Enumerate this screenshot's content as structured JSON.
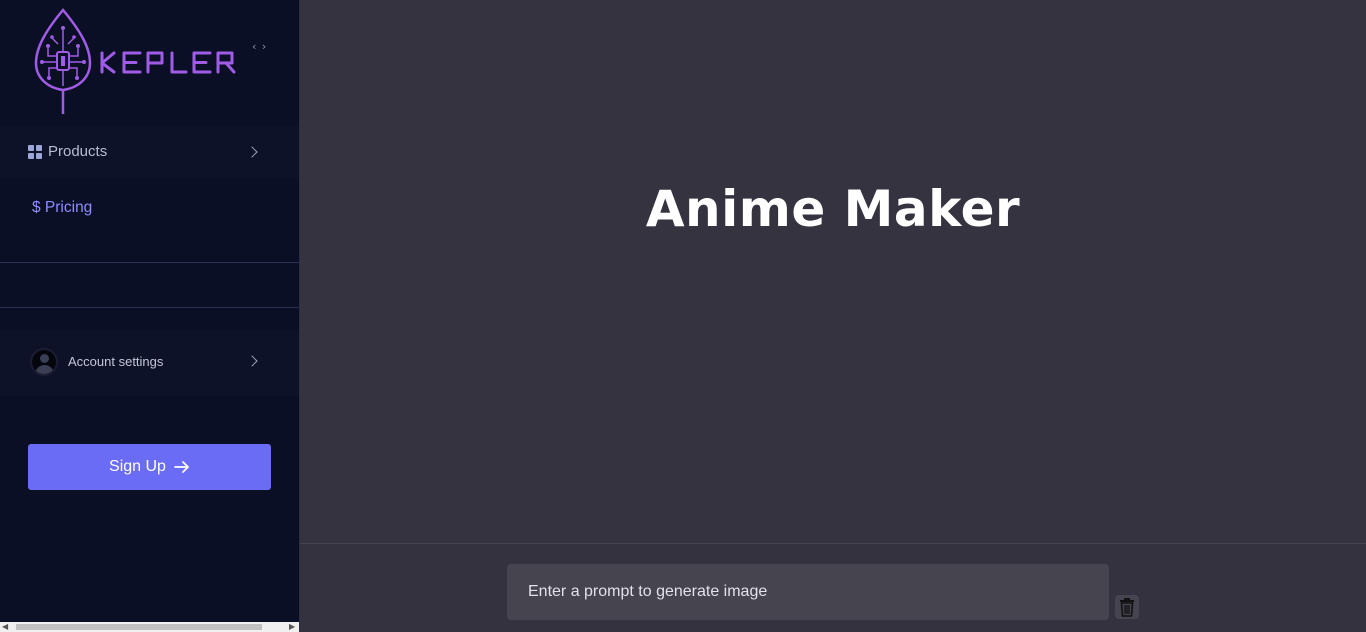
{
  "brand": {
    "name": "KEPLER",
    "logo_icon": "circuit-leaf-logo",
    "accent": "#a05ce6"
  },
  "sidebar": {
    "collapse_toggle": "‹ ›",
    "items": [
      {
        "label": "Products",
        "icon": "grid-icon"
      },
      {
        "label": "$ Pricing",
        "icon": "dollar-icon"
      }
    ],
    "account": {
      "label": "Account settings",
      "icon": "avatar-icon"
    },
    "signup": {
      "label": "Sign Up",
      "icon": "arrow-right-icon",
      "color": "#6a6cf6"
    }
  },
  "main": {
    "title": "Anime Maker",
    "prompt": {
      "placeholder": "Enter a prompt to generate image",
      "value": ""
    },
    "trash_icon": "trash-icon"
  },
  "colors": {
    "sidebar_bg": "#0b0f26",
    "main_bg": "#34333f",
    "pricing_text": "#8e8cff"
  }
}
